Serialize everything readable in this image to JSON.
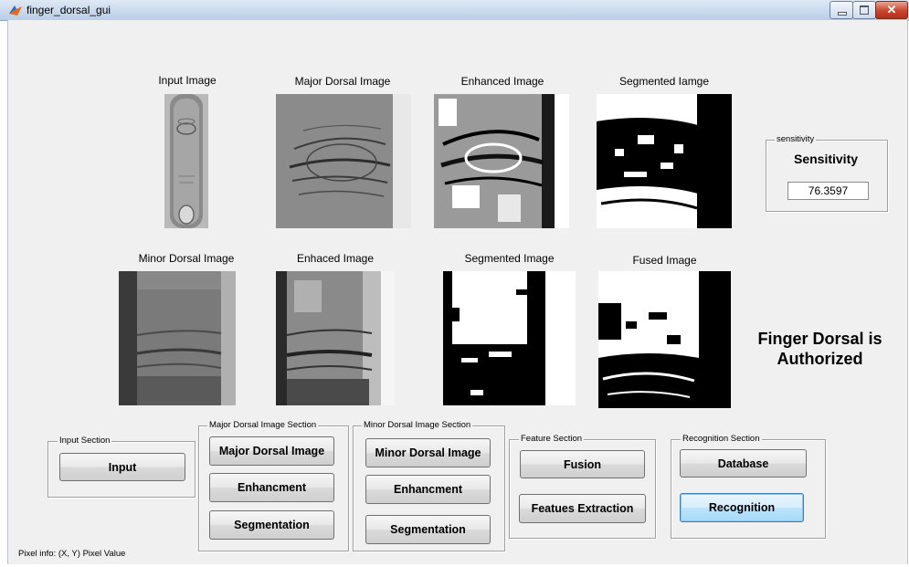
{
  "window": {
    "title": "finger_dorsal_gui"
  },
  "images_row1": [
    {
      "label": "Input Image"
    },
    {
      "label": "Major Dorsal Image"
    },
    {
      "label": "Enhanced Image"
    },
    {
      "label": "Segmented Iamge"
    }
  ],
  "images_row2": [
    {
      "label": "Minor Dorsal Image"
    },
    {
      "label": "Enhaced Image"
    },
    {
      "label": "Segmented Image"
    },
    {
      "label": "Fused Image"
    }
  ],
  "sensitivity": {
    "panel_title": "sensitivity",
    "heading": "Sensitivity",
    "value": "76.3597"
  },
  "result": {
    "line1": "Finger Dorsal is",
    "line2": "Authorized"
  },
  "sections": {
    "input": {
      "title": "Input Section",
      "buttons": [
        "Input"
      ]
    },
    "major": {
      "title": "Major Dorsal Image Section",
      "buttons": [
        "Major Dorsal Image",
        "Enhancment",
        "Segmentation"
      ]
    },
    "minor": {
      "title": "Minor Dorsal Image Section",
      "buttons": [
        "Minor Dorsal Image",
        "Enhancment",
        "Segmentation"
      ]
    },
    "feature": {
      "title": "Feature Section",
      "buttons": [
        "Fusion",
        "Featues Extraction"
      ]
    },
    "recognition": {
      "title": "Recognition Section",
      "buttons": [
        "Database",
        "Recognition"
      ]
    }
  },
  "status": {
    "pixel_info": "Pixel info: (X, Y)  Pixel Value"
  },
  "colors": {
    "frame": "#f0f0f0",
    "titlebar": "#c8d8ec",
    "close": "#c9452c"
  }
}
